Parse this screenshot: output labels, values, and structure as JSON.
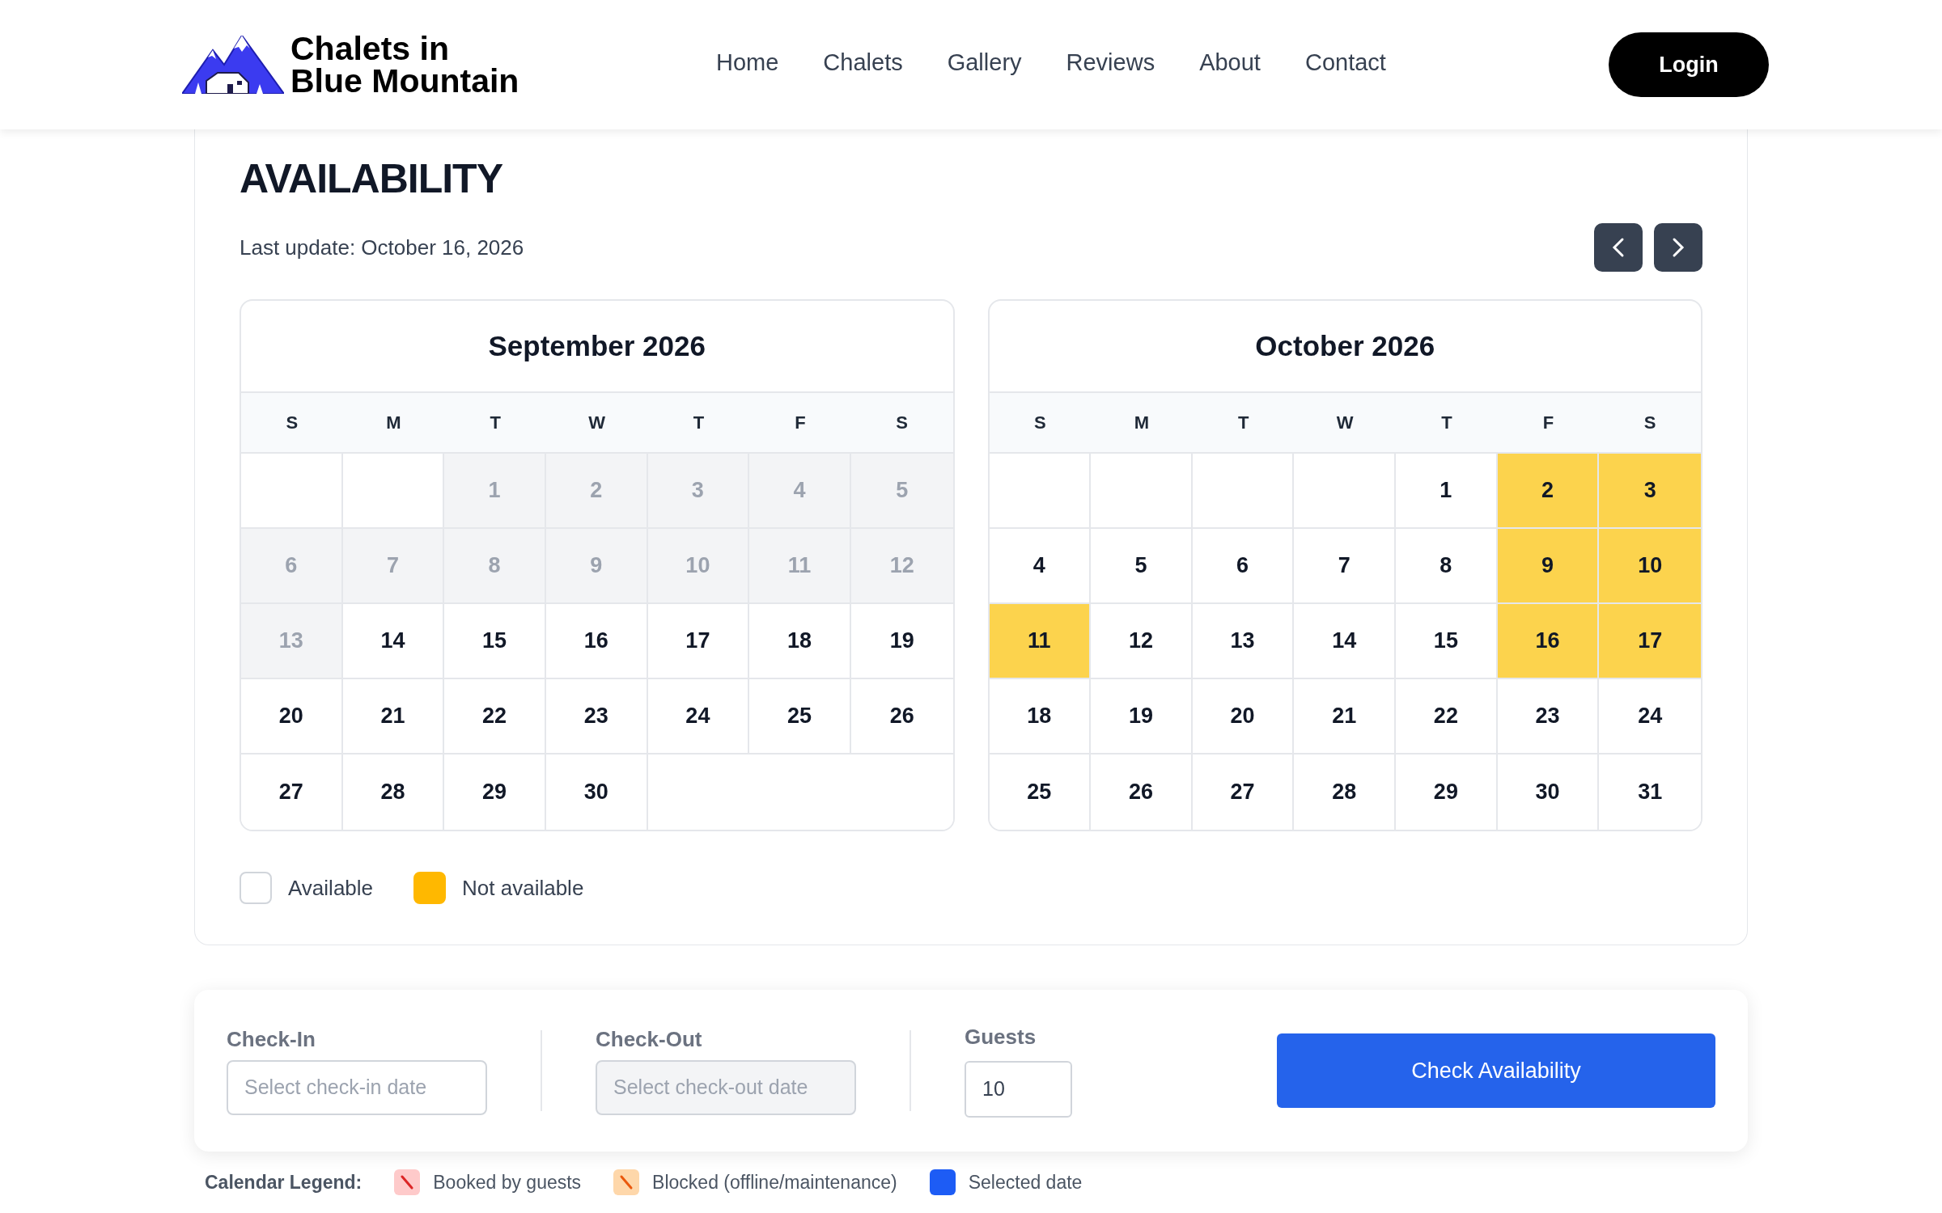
{
  "header": {
    "logo_lines": [
      "Chalets in",
      "Blue Mountain"
    ],
    "nav": [
      {
        "label": "Home"
      },
      {
        "label": "Chalets"
      },
      {
        "label": "Gallery"
      },
      {
        "label": "Reviews"
      },
      {
        "label": "About"
      },
      {
        "label": "Contact"
      }
    ],
    "login": "Login"
  },
  "availability": {
    "title": "AVAILABILITY",
    "last_update": "Last update: October 16, 2026",
    "calendars": [
      {
        "month": "September 2026",
        "weekdays": [
          "S",
          "M",
          "T",
          "W",
          "T",
          "F",
          "S"
        ],
        "weeks": [
          [
            {
              "kind": "blank"
            },
            {
              "kind": "blank"
            },
            {
              "kind": "past",
              "day": "1"
            },
            {
              "kind": "past",
              "day": "2"
            },
            {
              "kind": "past",
              "day": "3"
            },
            {
              "kind": "past",
              "day": "4"
            },
            {
              "kind": "past",
              "day": "5"
            }
          ],
          [
            {
              "kind": "past",
              "day": "6"
            },
            {
              "kind": "past",
              "day": "7"
            },
            {
              "kind": "past",
              "day": "8"
            },
            {
              "kind": "past",
              "day": "9"
            },
            {
              "kind": "past",
              "day": "10"
            },
            {
              "kind": "past",
              "day": "11"
            },
            {
              "kind": "past",
              "day": "12"
            }
          ],
          [
            {
              "kind": "past",
              "day": "13"
            },
            {
              "kind": "open",
              "day": "14"
            },
            {
              "kind": "open",
              "day": "15"
            },
            {
              "kind": "open",
              "day": "16"
            },
            {
              "kind": "open",
              "day": "17"
            },
            {
              "kind": "open",
              "day": "18"
            },
            {
              "kind": "open",
              "day": "19"
            }
          ],
          [
            {
              "kind": "open",
              "day": "20"
            },
            {
              "kind": "open",
              "day": "21"
            },
            {
              "kind": "open",
              "day": "22"
            },
            {
              "kind": "open",
              "day": "23"
            },
            {
              "kind": "open",
              "day": "24"
            },
            {
              "kind": "open",
              "day": "25"
            },
            {
              "kind": "open",
              "day": "26"
            }
          ],
          [
            {
              "kind": "open",
              "day": "27"
            },
            {
              "kind": "open",
              "day": "28"
            },
            {
              "kind": "open",
              "day": "29"
            },
            {
              "kind": "open",
              "day": "30"
            },
            {
              "kind": "blank"
            },
            {
              "kind": "blank"
            },
            {
              "kind": "blank"
            }
          ]
        ]
      },
      {
        "month": "October 2026",
        "weekdays": [
          "S",
          "M",
          "T",
          "W",
          "T",
          "F",
          "S"
        ],
        "weeks": [
          [
            {
              "kind": "blank"
            },
            {
              "kind": "blank"
            },
            {
              "kind": "blank"
            },
            {
              "kind": "blank"
            },
            {
              "kind": "open",
              "day": "1"
            },
            {
              "kind": "booked",
              "day": "2"
            },
            {
              "kind": "booked",
              "day": "3"
            }
          ],
          [
            {
              "kind": "open",
              "day": "4"
            },
            {
              "kind": "open",
              "day": "5"
            },
            {
              "kind": "open",
              "day": "6"
            },
            {
              "kind": "open",
              "day": "7"
            },
            {
              "kind": "open",
              "day": "8"
            },
            {
              "kind": "booked",
              "day": "9"
            },
            {
              "kind": "booked",
              "day": "10"
            }
          ],
          [
            {
              "kind": "booked",
              "day": "11"
            },
            {
              "kind": "open",
              "day": "12"
            },
            {
              "kind": "open",
              "day": "13"
            },
            {
              "kind": "open",
              "day": "14"
            },
            {
              "kind": "open",
              "day": "15"
            },
            {
              "kind": "booked",
              "day": "16"
            },
            {
              "kind": "booked",
              "day": "17"
            }
          ],
          [
            {
              "kind": "open",
              "day": "18"
            },
            {
              "kind": "open",
              "day": "19"
            },
            {
              "kind": "open",
              "day": "20"
            },
            {
              "kind": "open",
              "day": "21"
            },
            {
              "kind": "open",
              "day": "22"
            },
            {
              "kind": "open",
              "day": "23"
            },
            {
              "kind": "open",
              "day": "24"
            }
          ],
          [
            {
              "kind": "open",
              "day": "25"
            },
            {
              "kind": "open",
              "day": "26"
            },
            {
              "kind": "open",
              "day": "27"
            },
            {
              "kind": "open",
              "day": "28"
            },
            {
              "kind": "open",
              "day": "29"
            },
            {
              "kind": "open",
              "day": "30"
            },
            {
              "kind": "open",
              "day": "31"
            }
          ]
        ]
      }
    ],
    "legend": [
      {
        "label": "Available",
        "color": "#ffffff"
      },
      {
        "label": "Not available",
        "color": "#ffb800"
      }
    ]
  },
  "booking": {
    "fields": [
      {
        "label": "Check-In",
        "placeholder": "Select check-in date",
        "disabled": false
      },
      {
        "label": "Check-Out",
        "placeholder": "Select check-out date",
        "disabled": true
      }
    ],
    "guests": {
      "label": "Guests",
      "value": "10"
    },
    "button": "Check Availability"
  },
  "calendar_legend": {
    "title": "Calendar Legend:",
    "items": [
      {
        "kind": "booked",
        "label": "Booked by guests",
        "color": "#fecaca"
      },
      {
        "kind": "blocked",
        "label": "Blocked (offline/maintenance)",
        "color": "#fed7aa"
      },
      {
        "kind": "selected",
        "label": "Selected date",
        "color": "#1d5cf5"
      }
    ]
  }
}
